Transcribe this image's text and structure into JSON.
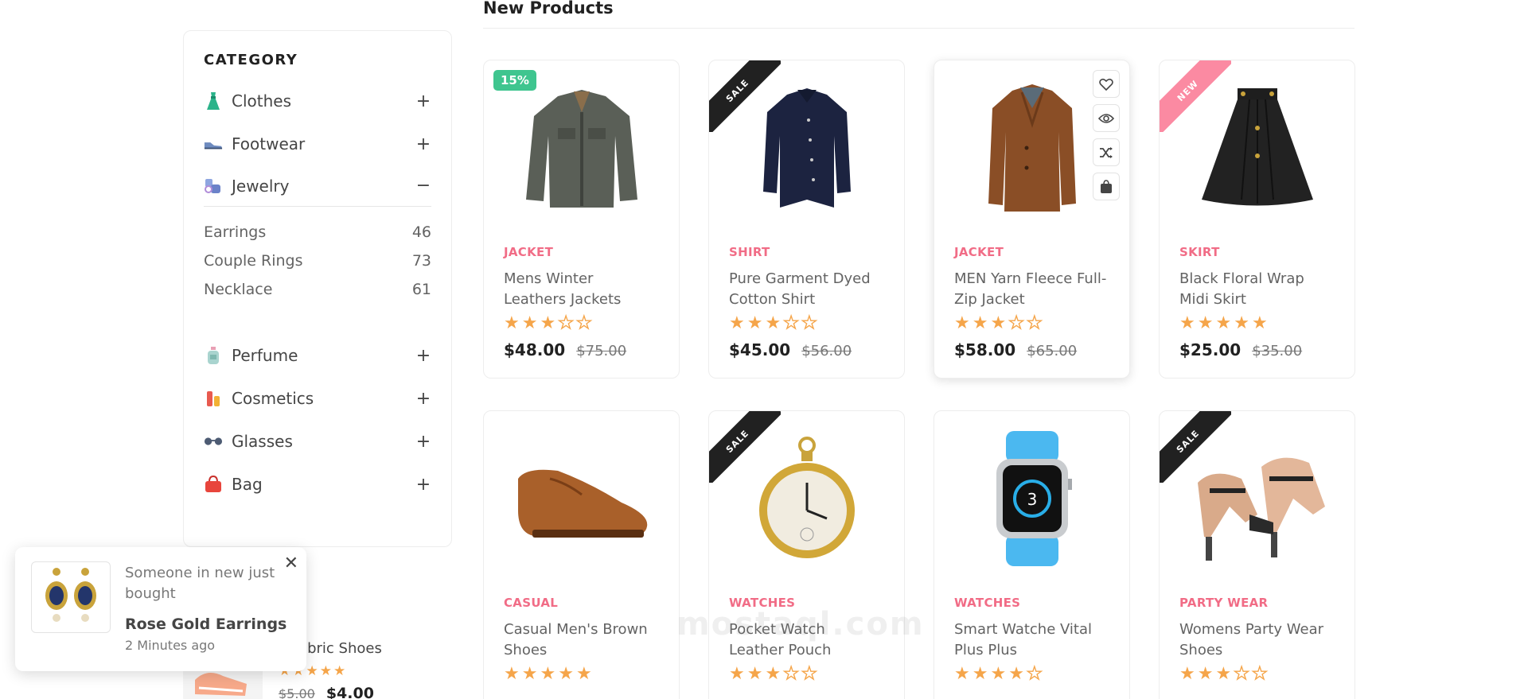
{
  "section": {
    "title": "New Products"
  },
  "sidebar": {
    "title": "CATEGORY",
    "categories": [
      {
        "label": "Clothes",
        "icon": "dress-icon",
        "toggle": "+"
      },
      {
        "label": "Footwear",
        "icon": "shoe-icon",
        "toggle": "+"
      },
      {
        "label": "Jewelry",
        "icon": "jewelry-icon",
        "toggle": "−"
      },
      {
        "label": "Perfume",
        "icon": "perfume-icon",
        "toggle": "+"
      },
      {
        "label": "Cosmetics",
        "icon": "cosmetics-icon",
        "toggle": "+"
      },
      {
        "label": "Glasses",
        "icon": "glasses-icon",
        "toggle": "+"
      },
      {
        "label": "Bag",
        "icon": "bag-icon",
        "toggle": "+"
      }
    ],
    "jewelry_sub": [
      {
        "label": "Earrings",
        "count": "46"
      },
      {
        "label": "Couple Rings",
        "count": "73"
      },
      {
        "label": "Necklace",
        "count": "61"
      }
    ]
  },
  "products": [
    {
      "category": "JACKET",
      "title": "Mens Winter Leathers Jackets",
      "price": "$48.00",
      "old_price": "$75.00",
      "rating": 3,
      "badge": "15%"
    },
    {
      "category": "SHIRT",
      "title": "Pure Garment Dyed Cotton Shirt",
      "price": "$45.00",
      "old_price": "$56.00",
      "rating": 3,
      "badge": "SALE"
    },
    {
      "category": "JACKET",
      "title": "MEN Yarn Fleece Full-Zip Jacket",
      "price": "$58.00",
      "old_price": "$65.00",
      "rating": 3,
      "badge": ""
    },
    {
      "category": "SKIRT",
      "title": "Black Floral Wrap Midi Skirt",
      "price": "$25.00",
      "old_price": "$35.00",
      "rating": 5,
      "badge": "NEW"
    },
    {
      "category": "CASUAL",
      "title": "Casual Men's Brown Shoes",
      "price": "",
      "old_price": "",
      "rating": 5,
      "badge": ""
    },
    {
      "category": "WATCHES",
      "title": "Pocket Watch Leather Pouch",
      "price": "",
      "old_price": "",
      "rating": 3,
      "badge": "SALE"
    },
    {
      "category": "WATCHES",
      "title": "Smart Watche Vital Plus Plus",
      "price": "",
      "old_price": "",
      "rating": 4,
      "badge": ""
    },
    {
      "category": "PARTY WEAR",
      "title": "Womens Party Wear Shoes",
      "price": "",
      "old_price": "",
      "rating": 3,
      "badge": "SALE"
    }
  ],
  "toast": {
    "message": "Someone in new just bought",
    "product": "Rose Gold Earrings",
    "time": "2 Minutes ago",
    "close": "✕"
  },
  "best_seller": {
    "title": "y Fabric Shoes",
    "old_price": "$5.00",
    "price": "$4.00",
    "rating": 5
  },
  "watermark": "mostaql.com",
  "colors": {
    "accent": "#f16c86",
    "star": "#f5a54a",
    "green_badge": "#3fc58f",
    "new_ribbon": "#fb8aa2"
  }
}
